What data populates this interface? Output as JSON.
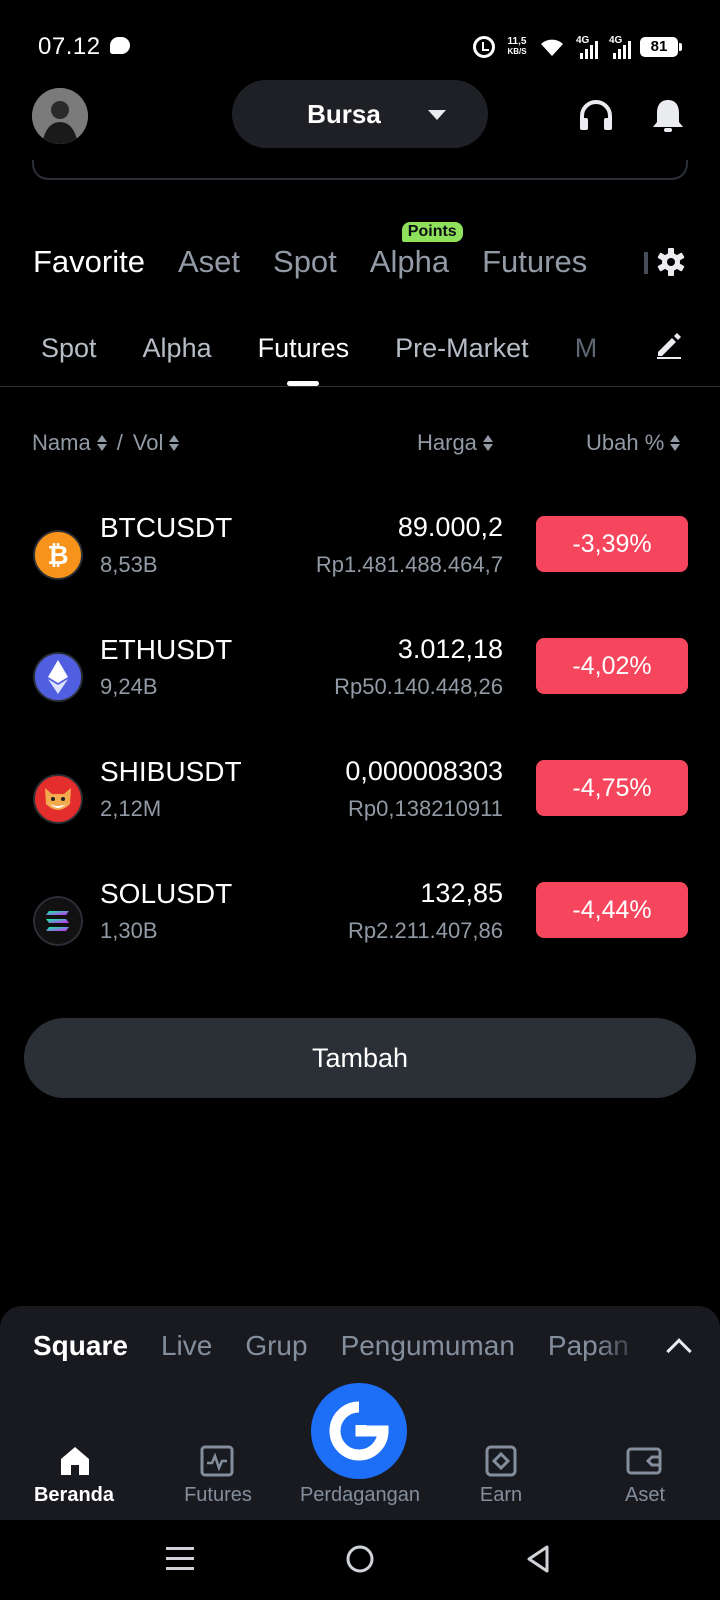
{
  "status_bar": {
    "time": "07.12",
    "net_speed_value": "11,5",
    "net_speed_unit": "KB/S",
    "signal1": "4G",
    "signal2": "4G",
    "battery": "81"
  },
  "header": {
    "selector_label": "Bursa"
  },
  "top_tabs": [
    {
      "label": "Favorite",
      "active": true
    },
    {
      "label": "Aset"
    },
    {
      "label": "Spot"
    },
    {
      "label": "Alpha",
      "badge": "Points"
    },
    {
      "label": "Futures"
    }
  ],
  "sub_tabs": [
    {
      "label": "Spot"
    },
    {
      "label": "Alpha"
    },
    {
      "label": "Futures",
      "active": true
    },
    {
      "label": "Pre-Market"
    },
    {
      "label": "M"
    }
  ],
  "columns": {
    "name": "Nama",
    "sep": "/",
    "vol": "Vol",
    "price": "Harga",
    "change": "Ubah %"
  },
  "rows": [
    {
      "symbol": "BTCUSDT",
      "volume": "8,53B",
      "price": "89.000,2",
      "idr": "Rp1.481.488.464,7",
      "change": "-3,39%",
      "icon": "bitcoin-icon",
      "color": "#f7931a"
    },
    {
      "symbol": "ETHUSDT",
      "volume": "9,24B",
      "price": "3.012,18",
      "idr": "Rp50.140.448,26",
      "change": "-4,02%",
      "icon": "ethereum-icon",
      "color": "#4f5fe0"
    },
    {
      "symbol": "SHIBUSDT",
      "volume": "2,12M",
      "price": "0,000008303",
      "idr": "Rp0,138210911",
      "change": "-4,75%",
      "icon": "shiba-icon",
      "color": "#e42d2d"
    },
    {
      "symbol": "SOLUSDT",
      "volume": "1,30B",
      "price": "132,85",
      "idr": "Rp2.211.407,86",
      "change": "-4,44%",
      "icon": "solana-icon",
      "color": "#111111"
    }
  ],
  "add_button": "Tambah",
  "square_tabs": [
    {
      "label": "Square",
      "active": true
    },
    {
      "label": "Live"
    },
    {
      "label": "Grup"
    },
    {
      "label": "Pengumuman"
    },
    {
      "label": "Papan"
    }
  ],
  "bottom_nav": [
    {
      "label": "Beranda",
      "icon": "home-icon",
      "active": true
    },
    {
      "label": "Futures",
      "icon": "futures-icon"
    },
    {
      "label": "Perdagangan",
      "icon": "trade-icon"
    },
    {
      "label": "Earn",
      "icon": "earn-icon"
    },
    {
      "label": "Aset",
      "icon": "wallet-icon"
    }
  ],
  "colors": {
    "negative": "#f6465d",
    "accent_blue": "#1e6ff7",
    "badge_green": "#8fe05b"
  }
}
